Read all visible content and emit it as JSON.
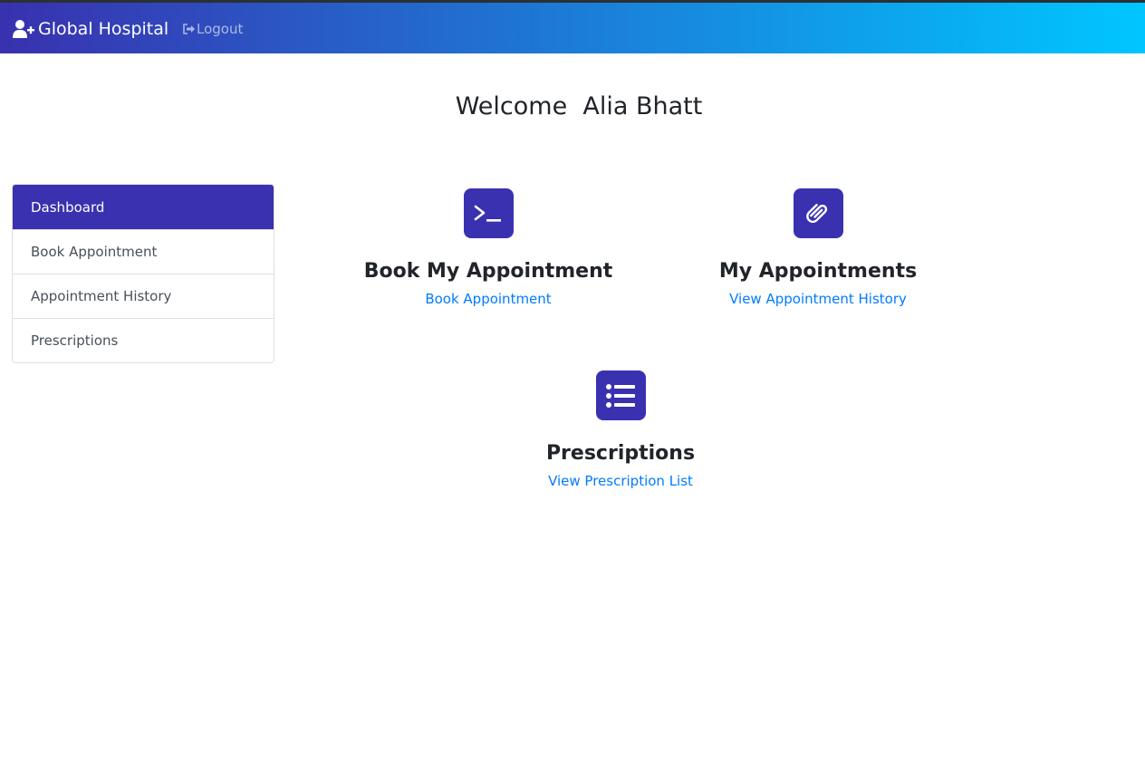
{
  "navbar": {
    "brand": "Global Hospital",
    "brand_icon": "user-plus-icon",
    "logout_label": "Logout",
    "logout_icon": "sign-out-icon",
    "gradient_start": "#3931af",
    "gradient_end": "#00c6ff"
  },
  "welcome": "Welcome  Alia Bhatt",
  "sidebar": {
    "items": [
      {
        "label": "Dashboard",
        "active": true
      },
      {
        "label": "Book Appointment",
        "active": false
      },
      {
        "label": "Appointment History",
        "active": false
      },
      {
        "label": "Prescriptions",
        "active": false
      }
    ],
    "active_color": "#3931af"
  },
  "cards": [
    {
      "title": "Book My Appointment",
      "link": "Book Appointment",
      "icon": "terminal-icon"
    },
    {
      "title": "My Appointments",
      "link": "View Appointment History",
      "icon": "paperclip-icon"
    },
    {
      "title": "Prescriptions",
      "link": "View Prescription List",
      "icon": "list-icon"
    }
  ],
  "colors": {
    "link": "#007bff",
    "tile": "#3931af"
  }
}
